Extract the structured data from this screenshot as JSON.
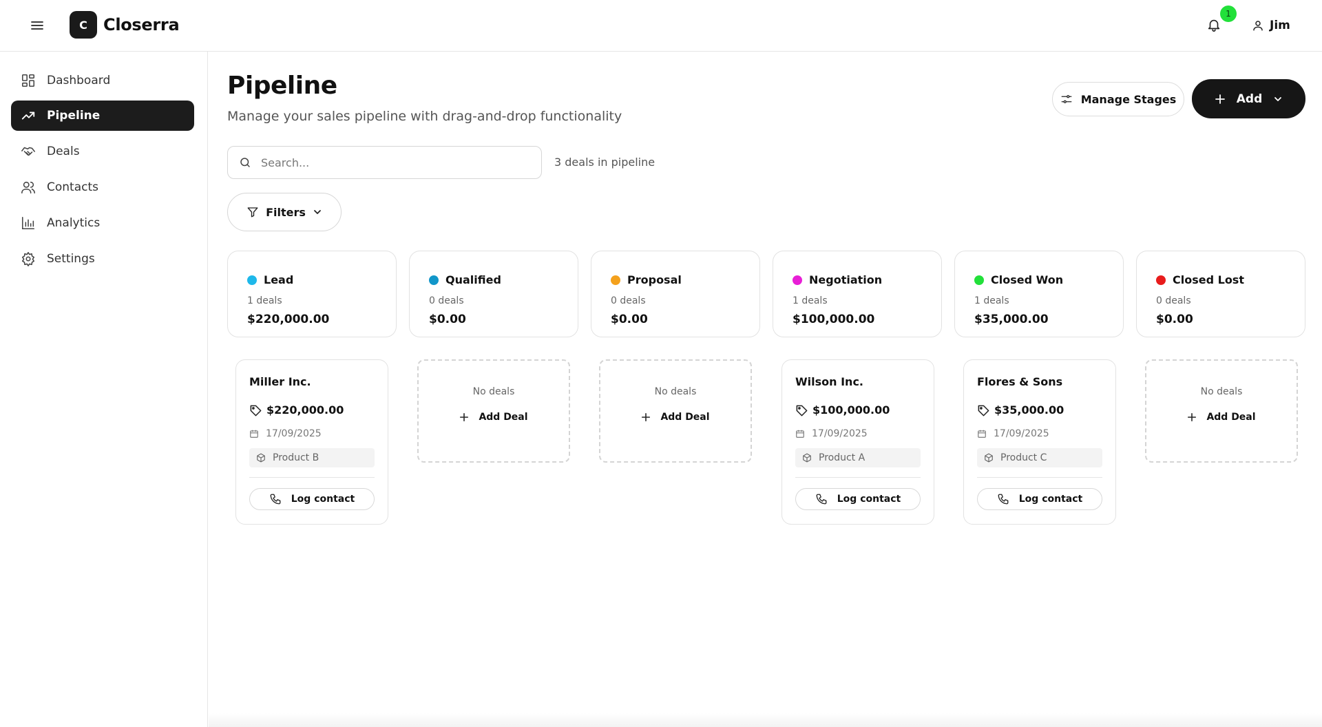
{
  "app": {
    "logo_letter": "C",
    "name": "Closerra"
  },
  "header": {
    "notification_count": "1",
    "user_name": "Jim"
  },
  "sidebar": {
    "items": [
      {
        "label": "Dashboard",
        "icon": "dashboard-icon"
      },
      {
        "label": "Pipeline",
        "icon": "trending-up-icon",
        "active": true
      },
      {
        "label": "Deals",
        "icon": "handshake-icon"
      },
      {
        "label": "Contacts",
        "icon": "users-icon"
      },
      {
        "label": "Analytics",
        "icon": "bar-chart-icon"
      },
      {
        "label": "Settings",
        "icon": "gear-icon"
      }
    ]
  },
  "main": {
    "title": "Pipeline",
    "subtitle": "Manage your sales pipeline with drag-and-drop functionality",
    "manage_stages_label": "Manage Stages",
    "add_label": "Add",
    "search_placeholder": "Search...",
    "deal_count_text": "3 deals in pipeline",
    "filters_label": "Filters"
  },
  "stages": [
    {
      "name": "Lead",
      "color": "#1eb8ea",
      "count": "1 deals",
      "total": "$220,000.00"
    },
    {
      "name": "Qualified",
      "color": "#1196c9",
      "count": "0 deals",
      "total": "$0.00"
    },
    {
      "name": "Proposal",
      "color": "#f4a11d",
      "count": "0 deals",
      "total": "$0.00"
    },
    {
      "name": "Negotiation",
      "color": "#e81fd6",
      "count": "1 deals",
      "total": "$100,000.00"
    },
    {
      "name": "Closed Won",
      "color": "#22e03a",
      "count": "1 deals",
      "total": "$35,000.00"
    },
    {
      "name": "Closed Lost",
      "color": "#e81c1c",
      "count": "0 deals",
      "total": "$0.00"
    }
  ],
  "deals": [
    {
      "title": "Miller Inc.",
      "amount": "$220,000.00",
      "date": "17/09/2025",
      "product": "Product B",
      "action": "Log contact"
    },
    {
      "title": "Wilson Inc.",
      "amount": "$100,000.00",
      "date": "17/09/2025",
      "product": "Product A",
      "action": "Log contact"
    },
    {
      "title": "Flores & Sons",
      "amount": "$35,000.00",
      "date": "17/09/2025",
      "product": "Product C",
      "action": "Log contact"
    }
  ],
  "empty_column": {
    "text": "No deals",
    "add_label": "Add Deal"
  }
}
